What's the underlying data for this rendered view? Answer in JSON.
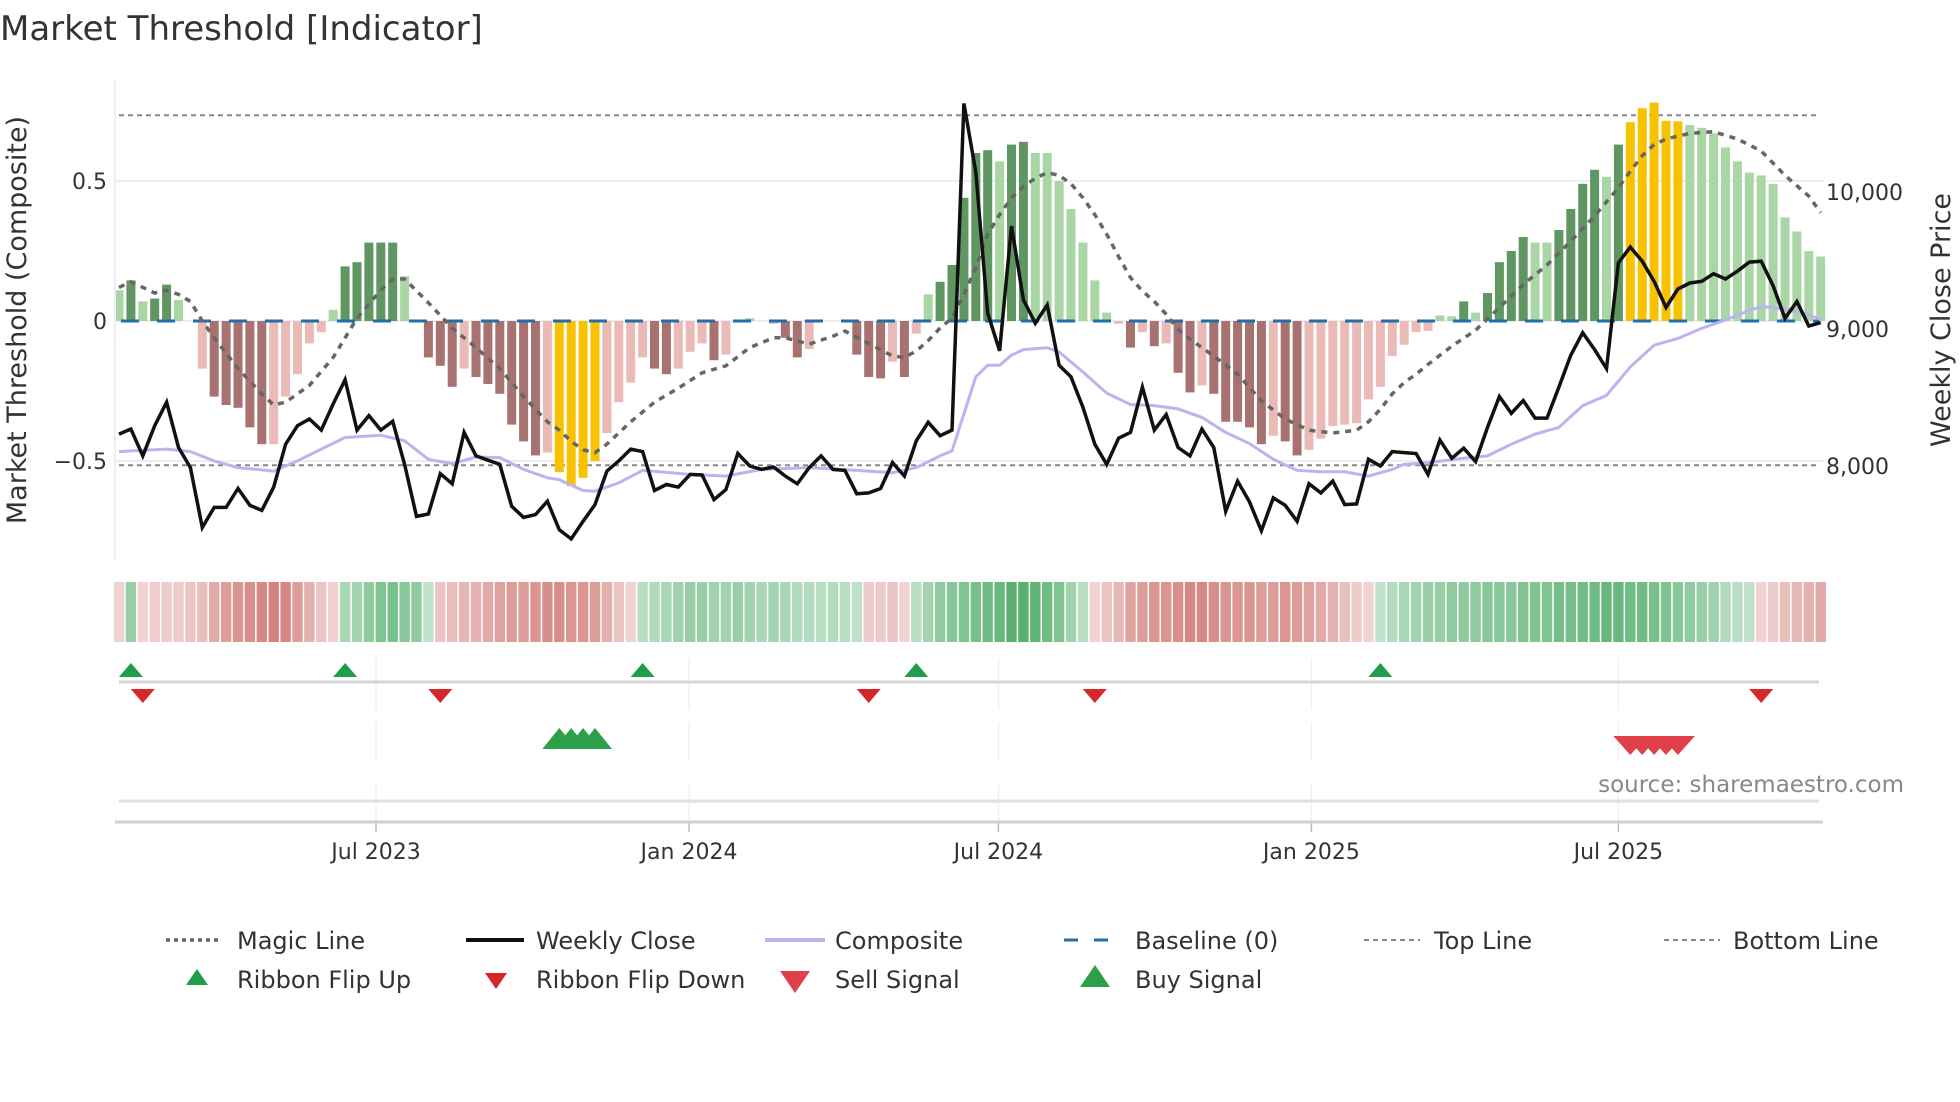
{
  "title": "Market Threshold [Indicator]",
  "source": "source: sharemaestro.com",
  "chart_data": {
    "type": "bar+line",
    "title": "Market Threshold [Indicator]",
    "ylabel_left": "Market Threshold (Composite)",
    "ylabel_right": "Weekly Close Price",
    "x_unit": "week index (weekly bars, ~Feb 2023 to Oct 2025)",
    "ylim_left": [
      -0.86,
      0.92
    ],
    "ylim_right": [
      7380,
      10700
    ],
    "left_ticks": [
      {
        "v": 0.5,
        "label": "0.5"
      },
      {
        "v": 0,
        "label": "0"
      },
      {
        "v": -0.5,
        "label": "−0.5"
      }
    ],
    "right_ticks": [
      {
        "v": 10000,
        "label": "10,000"
      },
      {
        "v": 9000,
        "label": "9,000"
      },
      {
        "v": 8000,
        "label": "8,000"
      }
    ],
    "x_ticks": [
      {
        "w": 21.6,
        "label": "Jul 2023"
      },
      {
        "w": 47.9,
        "label": "Jan 2024"
      },
      {
        "w": 73.9,
        "label": "Jul 2024"
      },
      {
        "w": 100.2,
        "label": "Jan 2025"
      },
      {
        "w": 126.0,
        "label": "Jul 2025"
      }
    ],
    "top_line": 0.735,
    "bottom_line": -0.515,
    "baseline": 0,
    "composite_bars": [
      0.11,
      0.145,
      0.07,
      0.08,
      0.13,
      0.075,
      0,
      -0.17,
      -0.27,
      -0.3,
      -0.31,
      -0.38,
      -0.44,
      -0.44,
      -0.27,
      -0.19,
      -0.08,
      -0.04,
      0.04,
      0.195,
      0.21,
      0.28,
      0.28,
      0.28,
      0.16,
      0,
      -0.13,
      -0.16,
      -0.235,
      -0.17,
      -0.2,
      -0.225,
      -0.26,
      -0.37,
      -0.43,
      -0.48,
      -0.47,
      -0.54,
      -0.59,
      -0.56,
      -0.5,
      -0.4,
      -0.29,
      -0.22,
      -0.13,
      -0.17,
      -0.19,
      -0.17,
      -0.11,
      -0.08,
      -0.14,
      -0.12,
      0,
      0.01,
      0,
      -0.01,
      -0.06,
      -0.13,
      -0.1,
      0,
      0,
      0,
      -0.12,
      -0.2,
      -0.205,
      -0.145,
      -0.2,
      -0.045,
      0.095,
      0.14,
      0.2,
      0.44,
      0.6,
      0.61,
      0.57,
      0.63,
      0.64,
      0.6,
      0.6,
      0.5,
      0.4,
      0.28,
      0.145,
      0.03,
      -0.01,
      -0.095,
      -0.04,
      -0.09,
      -0.08,
      -0.185,
      -0.255,
      -0.23,
      -0.26,
      -0.36,
      -0.36,
      -0.38,
      -0.44,
      -0.41,
      -0.43,
      -0.48,
      -0.46,
      -0.42,
      -0.375,
      -0.37,
      -0.365,
      -0.28,
      -0.235,
      -0.125,
      -0.085,
      -0.04,
      -0.035,
      0.02,
      0.017,
      0.07,
      0.03,
      0.1,
      0.21,
      0.25,
      0.3,
      0.28,
      0.28,
      0.325,
      0.4,
      0.49,
      0.54,
      0.515,
      0.63,
      0.71,
      0.76,
      0.78,
      0.715,
      0.713,
      0.7,
      0.69,
      0.67,
      0.62,
      0.57,
      0.53,
      0.52,
      0.49,
      0.37,
      0.32,
      0.25,
      0.23
    ],
    "bar_state_codes": "gGgGGgrrRRRRRrrrrrgGGGGGgrRRRrRRRRRRrYYYYrrrrRRrrrRrrgrrRRrrrrRRRrRrgGGGGGgGGgggggggrRrRrRRrRRRRRrRRrrrrrrrrrrrggGgGGGGggGGGGgGYYYYYgggggggggggg",
    "bar_state_legend": {
      "G": "positive rising",
      "g": "positive falling",
      "R": "negative falling",
      "r": "negative rising",
      "Y": "extreme"
    },
    "weekly_close": [
      8233,
      8270,
      8074,
      8294,
      8466,
      8135,
      7988,
      7551,
      7698,
      7698,
      7836,
      7713,
      7676,
      7846,
      8159,
      8294,
      8343,
      8262,
      8453,
      8630,
      8262,
      8368,
      8262,
      8326,
      8012,
      7632,
      7650,
      7944,
      7870,
      8245,
      8074,
      8042,
      8012,
      7706,
      7625,
      7645,
      7743,
      7534,
      7468,
      7596,
      7718,
      7963,
      8037,
      8123,
      8105,
      7821,
      7865,
      7846,
      7939,
      7934,
      7755,
      7828,
      8091,
      8000,
      7975,
      7993,
      7926,
      7870,
      7988,
      8074,
      7975,
      7968,
      7797,
      7804,
      7836,
      8025,
      7926,
      8184,
      8319,
      8221,
      8262,
      10647,
      10145,
      9115,
      8841,
      9752,
      9213,
      9042,
      9176,
      8735,
      8650,
      8429,
      8159,
      8012,
      8203,
      8245,
      8576,
      8262,
      8375,
      8135,
      8074,
      8270,
      8135,
      7669,
      7890,
      7738,
      7527,
      7767,
      7713,
      7596,
      7870,
      7804,
      7890,
      7718,
      7723,
      8049,
      8000,
      8105,
      8098,
      8091,
      7939,
      8189,
      8056,
      8130,
      8032,
      8282,
      8507,
      8385,
      8478,
      8350,
      8350,
      8576,
      8809,
      8973,
      8850,
      8711,
      9483,
      9598,
      9495,
      9348,
      9157,
      9292,
      9336,
      9348,
      9404,
      9365,
      9422,
      9488,
      9495,
      9316,
      9078,
      9201,
      9022,
      9047
    ],
    "composite_line": [
      [
        0,
        8105
      ],
      [
        4,
        8123
      ],
      [
        6,
        8105
      ],
      [
        8,
        8037
      ],
      [
        10,
        7988
      ],
      [
        13,
        7963
      ],
      [
        15,
        8037
      ],
      [
        17,
        8123
      ],
      [
        19,
        8208
      ],
      [
        22,
        8225
      ],
      [
        24,
        8184
      ],
      [
        26,
        8049
      ],
      [
        28,
        8017
      ],
      [
        30,
        8066
      ],
      [
        32,
        8061
      ],
      [
        34,
        7975
      ],
      [
        36,
        7914
      ],
      [
        37,
        7900
      ],
      [
        39,
        7821
      ],
      [
        40,
        7816
      ],
      [
        42,
        7877
      ],
      [
        44,
        7968
      ],
      [
        48,
        7939
      ],
      [
        51,
        7926
      ],
      [
        54,
        7975
      ],
      [
        58,
        7988
      ],
      [
        62,
        7968
      ],
      [
        65,
        7951
      ],
      [
        67,
        7988
      ],
      [
        69,
        8074
      ],
      [
        70,
        8110
      ],
      [
        71,
        8380
      ],
      [
        72,
        8650
      ],
      [
        73,
        8735
      ],
      [
        74,
        8735
      ],
      [
        75,
        8809
      ],
      [
        76,
        8850
      ],
      [
        78,
        8863
      ],
      [
        79,
        8833
      ],
      [
        81,
        8686
      ],
      [
        83,
        8532
      ],
      [
        85,
        8449
      ],
      [
        87,
        8441
      ],
      [
        89,
        8417
      ],
      [
        91,
        8355
      ],
      [
        93,
        8245
      ],
      [
        95,
        8164
      ],
      [
        97,
        8049
      ],
      [
        99,
        7968
      ],
      [
        101,
        7958
      ],
      [
        103,
        7958
      ],
      [
        105,
        7926
      ],
      [
        107,
        7975
      ],
      [
        108,
        8012
      ],
      [
        110,
        8025
      ],
      [
        113,
        8056
      ],
      [
        115,
        8074
      ],
      [
        117,
        8159
      ],
      [
        119,
        8233
      ],
      [
        121,
        8282
      ],
      [
        123,
        8441
      ],
      [
        125,
        8515
      ],
      [
        127,
        8723
      ],
      [
        129,
        8882
      ],
      [
        131,
        8931
      ],
      [
        133,
        9005
      ],
      [
        135,
        9066
      ],
      [
        137,
        9135
      ],
      [
        138,
        9164
      ],
      [
        140,
        9145
      ],
      [
        142,
        9103
      ],
      [
        143,
        9071
      ]
    ],
    "magic_line": [
      [
        0,
        0.12
      ],
      [
        1,
        0.14
      ],
      [
        3,
        0.1
      ],
      [
        4,
        0.11
      ],
      [
        5,
        0.095
      ],
      [
        6,
        0.07
      ],
      [
        7,
        0
      ],
      [
        8,
        -0.06
      ],
      [
        10,
        -0.17
      ],
      [
        12,
        -0.26
      ],
      [
        13,
        -0.3
      ],
      [
        14,
        -0.29
      ],
      [
        16,
        -0.23
      ],
      [
        18,
        -0.13
      ],
      [
        19,
        -0.06
      ],
      [
        20,
        0.01
      ],
      [
        22,
        0.11
      ],
      [
        23,
        0.15
      ],
      [
        24,
        0.15
      ],
      [
        26,
        0.065
      ],
      [
        28,
        -0.025
      ],
      [
        30,
        -0.095
      ],
      [
        32,
        -0.17
      ],
      [
        34,
        -0.27
      ],
      [
        36,
        -0.36
      ],
      [
        37,
        -0.39
      ],
      [
        38,
        -0.43
      ],
      [
        39,
        -0.46
      ],
      [
        40,
        -0.47
      ],
      [
        41,
        -0.44
      ],
      [
        43,
        -0.36
      ],
      [
        45,
        -0.29
      ],
      [
        47,
        -0.24
      ],
      [
        49,
        -0.185
      ],
      [
        51,
        -0.16
      ],
      [
        53,
        -0.095
      ],
      [
        55,
        -0.06
      ],
      [
        56,
        -0.06
      ],
      [
        58,
        -0.083
      ],
      [
        60,
        -0.054
      ],
      [
        61,
        -0.036
      ],
      [
        63,
        -0.08
      ],
      [
        65,
        -0.125
      ],
      [
        66,
        -0.13
      ],
      [
        67,
        -0.107
      ],
      [
        68,
        -0.07
      ],
      [
        69,
        -0.025
      ],
      [
        70,
        0.01
      ],
      [
        71,
        0.095
      ],
      [
        72,
        0.19
      ],
      [
        73,
        0.31
      ],
      [
        74,
        0.38
      ],
      [
        75,
        0.44
      ],
      [
        76,
        0.48
      ],
      [
        77,
        0.51
      ],
      [
        78,
        0.53
      ],
      [
        79,
        0.52
      ],
      [
        80,
        0.49
      ],
      [
        81,
        0.44
      ],
      [
        82,
        0.38
      ],
      [
        83,
        0.31
      ],
      [
        84,
        0.23
      ],
      [
        85,
        0.155
      ],
      [
        86,
        0.107
      ],
      [
        87,
        0.07
      ],
      [
        88,
        0.024
      ],
      [
        89,
        -0.03
      ],
      [
        90,
        -0.065
      ],
      [
        92,
        -0.125
      ],
      [
        94,
        -0.19
      ],
      [
        96,
        -0.285
      ],
      [
        98,
        -0.35
      ],
      [
        100,
        -0.39
      ],
      [
        102,
        -0.4
      ],
      [
        104,
        -0.39
      ],
      [
        105,
        -0.36
      ],
      [
        106,
        -0.315
      ],
      [
        107,
        -0.26
      ],
      [
        108,
        -0.22
      ],
      [
        109,
        -0.19
      ],
      [
        110,
        -0.155
      ],
      [
        112,
        -0.09
      ],
      [
        114,
        -0.033
      ],
      [
        116,
        0.048
      ],
      [
        118,
        0.13
      ],
      [
        120,
        0.2
      ],
      [
        122,
        0.285
      ],
      [
        124,
        0.375
      ],
      [
        126,
        0.476
      ],
      [
        127,
        0.535
      ],
      [
        128,
        0.59
      ],
      [
        129,
        0.63
      ],
      [
        130,
        0.65
      ],
      [
        132,
        0.67
      ],
      [
        134,
        0.676
      ],
      [
        136,
        0.65
      ],
      [
        138,
        0.607
      ],
      [
        140,
        0.52
      ],
      [
        142,
        0.446
      ],
      [
        143,
        0.387
      ]
    ],
    "ribbon": [
      -0.15,
      0.45,
      -0.15,
      -0.2,
      -0.2,
      -0.2,
      -0.25,
      -0.3,
      -0.45,
      -0.55,
      -0.6,
      -0.65,
      -0.7,
      -0.75,
      -0.7,
      -0.55,
      -0.4,
      -0.25,
      -0.15,
      0.35,
      0.4,
      0.5,
      0.6,
      0.65,
      0.55,
      0.5,
      0.2,
      -0.25,
      -0.3,
      -0.35,
      -0.4,
      -0.45,
      -0.5,
      -0.55,
      -0.55,
      -0.6,
      -0.65,
      -0.65,
      -0.6,
      -0.6,
      -0.55,
      -0.4,
      -0.25,
      -0.15,
      0.25,
      0.3,
      0.35,
      0.4,
      0.45,
      0.45,
      0.4,
      0.4,
      0.45,
      0.4,
      0.35,
      0.4,
      0.35,
      0.3,
      0.3,
      0.25,
      0.3,
      0.25,
      0.2,
      -0.2,
      -0.2,
      -0.25,
      -0.15,
      0.25,
      0.4,
      0.5,
      0.55,
      0.6,
      0.65,
      0.7,
      0.75,
      0.85,
      0.85,
      0.8,
      0.7,
      0.6,
      0.4,
      0.25,
      -0.15,
      -0.25,
      -0.35,
      -0.5,
      -0.55,
      -0.6,
      -0.6,
      -0.65,
      -0.7,
      -0.7,
      -0.65,
      -0.6,
      -0.6,
      -0.6,
      -0.55,
      -0.55,
      -0.6,
      -0.55,
      -0.5,
      -0.45,
      -0.4,
      -0.3,
      -0.2,
      -0.15,
      0.2,
      0.3,
      0.35,
      0.4,
      0.45,
      0.45,
      0.5,
      0.5,
      0.5,
      0.55,
      0.55,
      0.55,
      0.6,
      0.6,
      0.6,
      0.65,
      0.65,
      0.7,
      0.7,
      0.75,
      0.75,
      0.7,
      0.7,
      0.65,
      0.6,
      0.55,
      0.5,
      0.45,
      0.4,
      0.3,
      0.25,
      0.2,
      -0.15,
      -0.2,
      -0.3,
      -0.35,
      -0.4,
      -0.45
    ],
    "ribbon_flip_up": [
      1,
      19,
      44,
      67,
      106
    ],
    "ribbon_flip_down": [
      2,
      27,
      63,
      82,
      138
    ],
    "buy_signals": [
      37,
      38,
      39,
      40
    ],
    "sell_signals": [
      127,
      128,
      129,
      130,
      131
    ],
    "legend": {
      "placement": "bottom",
      "items": [
        {
          "key": "magic",
          "label": "Magic Line"
        },
        {
          "key": "close",
          "label": "Weekly Close"
        },
        {
          "key": "composite",
          "label": "Composite"
        },
        {
          "key": "baseline",
          "label": "Baseline (0)"
        },
        {
          "key": "top",
          "label": "Top Line"
        },
        {
          "key": "bottom",
          "label": "Bottom Line"
        },
        {
          "key": "flipup",
          "label": "Ribbon Flip Up"
        },
        {
          "key": "flipdown",
          "label": "Ribbon Flip Down"
        },
        {
          "key": "sell",
          "label": "Sell Signal"
        },
        {
          "key": "buy",
          "label": "Buy Signal"
        }
      ]
    },
    "colors": {
      "G": "#5f9662",
      "g": "#aad6a5",
      "R": "#a87270",
      "r": "#e9bab6",
      "Y": "#f8c200",
      "close": "#111111",
      "composite": "#bdb3ef",
      "magic": "#666666",
      "baseline": "#1f6fa8",
      "refline": "#888888",
      "flip_up": "#1e9e48",
      "flip_down": "#d62728",
      "buy": "#2ca048",
      "sell": "#e0404a",
      "ribbon_pos": "#3ea55a",
      "ribbon_neg": "#c8605a"
    }
  }
}
